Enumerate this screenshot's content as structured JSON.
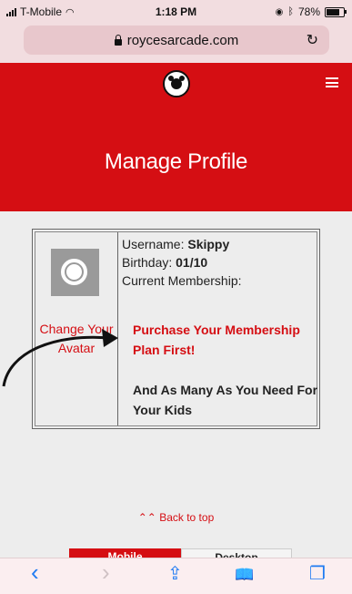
{
  "status": {
    "carrier": "T-Mobile",
    "time": "1:18 PM",
    "battery": "78%",
    "battery_level": 0.78
  },
  "browser": {
    "url": "roycesarcade.com",
    "reload_glyph": "↻"
  },
  "header": {
    "title": "Manage Profile",
    "bg_color": "#d50e13"
  },
  "profile": {
    "change_avatar": "Change Your Avatar",
    "username_label": "Username: ",
    "username_value": "Skippy",
    "birthday_label": "Birthday: ",
    "birthday_value": "01/10",
    "membership_label": "Current Membership:",
    "membership_cta": "Purchase Your Membership Plan First!",
    "membership_note": "And As Many As You Need For Your Kids"
  },
  "footer": {
    "back_to_top": "Back to top",
    "mobile_label": "Mobile",
    "desktop_label": "Desktop"
  },
  "toolbar": {
    "back": "‹",
    "forward": "›",
    "share": "⇪",
    "bookmarks": "📖",
    "tabs": "❐"
  }
}
